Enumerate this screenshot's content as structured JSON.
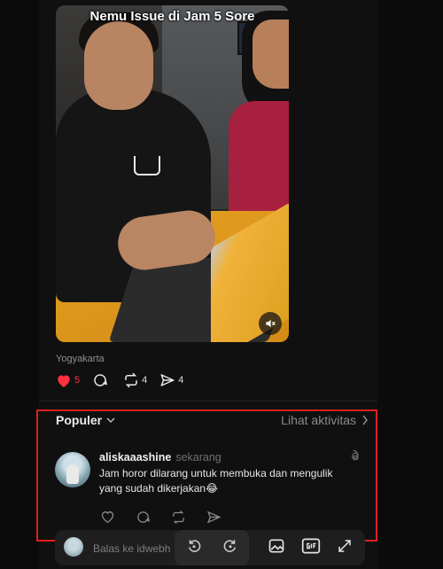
{
  "video": {
    "title": "Nemu Issue di Jam 5 Sore",
    "mute_icon": "speaker-muted-icon"
  },
  "post": {
    "location": "Yogyakarta",
    "likes": "5",
    "comments": "",
    "reposts": "4",
    "shares": "4",
    "like_color": "#ff3040"
  },
  "section": {
    "sort_label": "Populer",
    "activity_label": "Lihat aktivitas"
  },
  "comment": {
    "username": "aliskaaashine",
    "time": "sekarang",
    "text": "Jam horor dilarang untuk membuka dan mengulik yang sudah dikerjakan😂"
  },
  "reply": {
    "placeholder": "Balas ke idwebh"
  },
  "colors": {
    "highlight": "#e01e1e",
    "background": "#101010"
  }
}
